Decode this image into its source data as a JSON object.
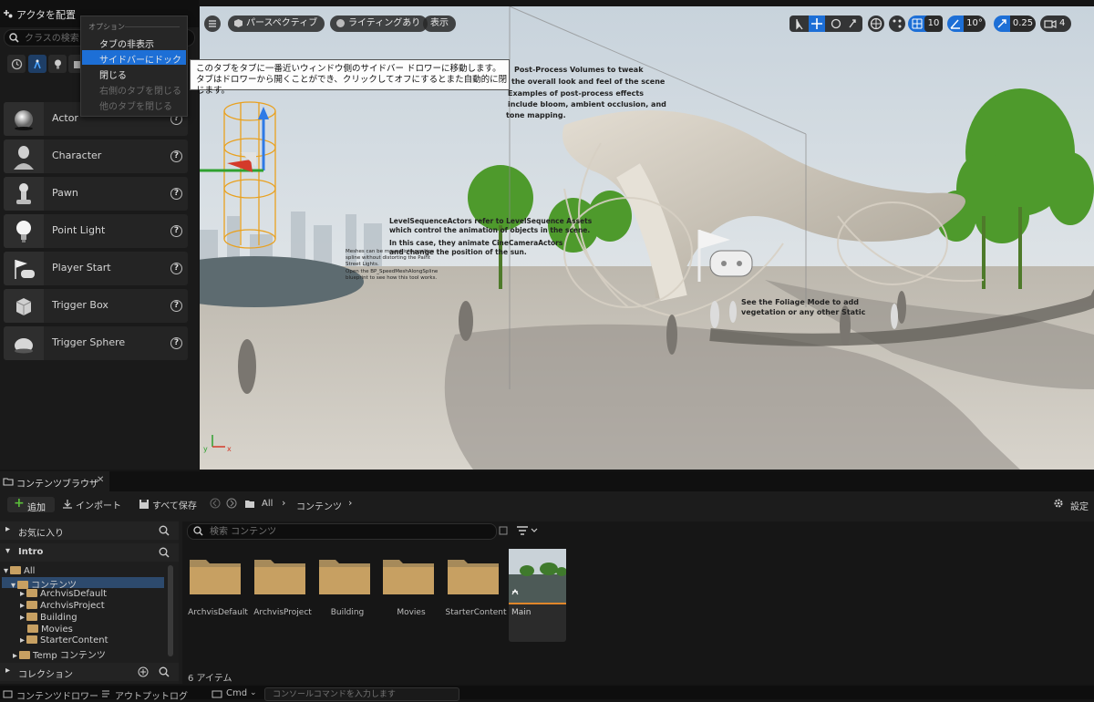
{
  "left_panel": {
    "title": "アクタを配置",
    "search_placeholder": "クラスの検索",
    "actors": [
      {
        "label": "Actor",
        "icon": "sphere-icon"
      },
      {
        "label": "Character",
        "icon": "character-icon"
      },
      {
        "label": "Pawn",
        "icon": "pawn-icon"
      },
      {
        "label": "Point Light",
        "icon": "lightbulb-icon"
      },
      {
        "label": "Player Start",
        "icon": "player-start-icon"
      },
      {
        "label": "Trigger Box",
        "icon": "cube-icon"
      },
      {
        "label": "Trigger Sphere",
        "icon": "trigger-sphere-icon"
      }
    ],
    "help_glyph": "?"
  },
  "context_menu": {
    "header": "オプション",
    "items": [
      {
        "label": "タブの非表示",
        "enabled": true,
        "selected": false
      },
      {
        "label": "サイドバーにドック",
        "enabled": true,
        "selected": true
      },
      {
        "label": "閉じる",
        "enabled": true,
        "selected": false
      },
      {
        "label": "右側のタブを閉じる",
        "enabled": false,
        "selected": false
      },
      {
        "label": "他のタブを閉じる",
        "enabled": false,
        "selected": false
      }
    ]
  },
  "tooltip": {
    "line1": "このタブをタブに一番近いウィンドウ側のサイドバー ドロワーに移動します。",
    "line2": "タブはドロワーから開くことができ、クリックしてオフにするとまた自動的に閉じます。"
  },
  "viewport": {
    "perspective_label": "パースペクティブ",
    "lighting_label": "ライティングあり",
    "show_label": "表示",
    "grid_snap": "10",
    "rotation_snap": "10°",
    "scale_snap": "0.25",
    "camera_speed": "4",
    "scene_text": {
      "pp_line1": "Post-Process Volumes to tweak",
      "pp_line2": "the overall look and feel of the scene",
      "pp_line3": "Examples of post-process effects",
      "pp_line4": "include bloom, ambient occlusion, and",
      "pp_line5": "tone mapping.",
      "ls_line1": "LevelSequenceActors refer to LevelSequence Assets",
      "ls_line2": "which control the animation of objects in the scene.",
      "ls_line3": "In this case, they animate CineCameraActors",
      "ls_line4": "and change the position of the sun.",
      "bp_line1": "Meshes can be moved into position",
      "bp_line2": "spline without distorting the Paint",
      "bp_line3": "Street Lights.",
      "bp_line4": "Open the BP_SpeedMeshAlongSpline",
      "bp_line5": "blueprint to see how this tool works.",
      "fol_line1": "See the Foliage Mode to add",
      "fol_line2": "vegetation or any other Static"
    },
    "axis_labels": {
      "x": "x",
      "y": "y"
    }
  },
  "content_browser": {
    "tab_label": "コンテンツブラウザ",
    "add_label": "追加",
    "import_label": "インポート",
    "save_all_label": "すべて保存",
    "path": [
      "All",
      "コンテンツ"
    ],
    "settings_label": "設定",
    "favorites_label": "お気に入り",
    "project_label": "Intro",
    "collections_label": "コレクション",
    "search_placeholder": "検索 コンテンツ",
    "item_count": "6 アイテム",
    "tree": {
      "root": "All",
      "content": "コンテンツ",
      "children": [
        "ArchvisDefault",
        "ArchvisProject",
        "Building",
        "Movies",
        "StarterContent"
      ],
      "temp": "Temp コンテンツ"
    },
    "assets": [
      "ArchvisDefault",
      "ArchvisProject",
      "Building",
      "Movies",
      "StarterContent",
      "Main"
    ]
  },
  "status_bar": {
    "content_drawer": "コンテンツドロワー",
    "output_log": "アウトプットログ",
    "cmd": "Cmd",
    "console_placeholder": "コンソールコマンドを入力します"
  },
  "colors": {
    "selection_blue": "#1d6fd6",
    "folder": "#c7a062",
    "add_green": "#5bbf3a"
  }
}
